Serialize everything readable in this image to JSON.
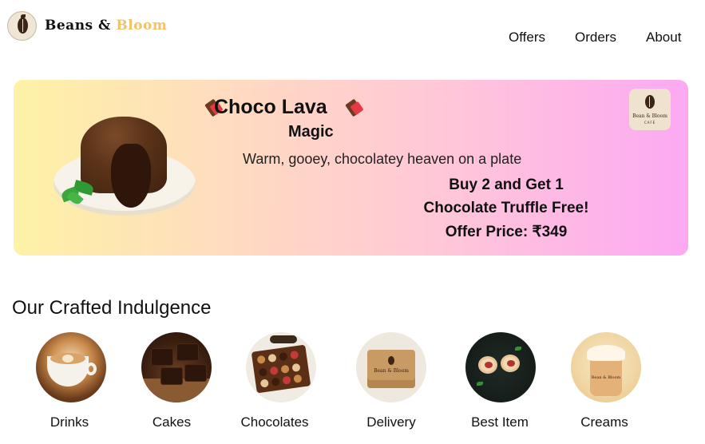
{
  "header": {
    "brand_part1": "Beans &",
    "brand_part2": "Bloom",
    "nav": [
      "Offers",
      "Orders",
      "About"
    ]
  },
  "banner": {
    "title": "Choco Lava",
    "subtitle": "Magic",
    "tagline": "Warm, gooey, chocolatey heaven on a plate",
    "offer_line1": "Buy 2  and Get 1",
    "offer_line2": "Chocolate Truffle Free!",
    "offer_line3": "Offer Price: ₹349",
    "badge_name": "Bean & Bloom",
    "badge_sub": "CAFÉ"
  },
  "section": {
    "title": "Our Crafted Indulgence"
  },
  "categories": [
    "Drinks",
    "Cakes",
    "Chocolates",
    "Delivery",
    "Best Item",
    "Creams"
  ],
  "product_text": {
    "box_label": "Bean & Bloom",
    "cup_label": "Bean & Bloom"
  },
  "colors": {
    "accent_gold": "#f2c26a",
    "banner_start": "#fdf2a6",
    "banner_end": "#fca9f3",
    "coffee_brown": "#3b2616"
  }
}
